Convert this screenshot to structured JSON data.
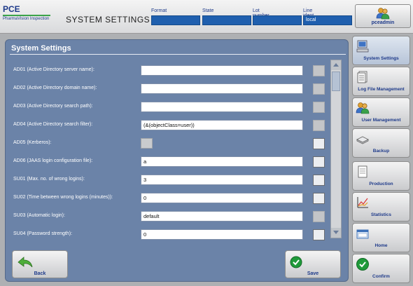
{
  "header": {
    "logo_title": "PCE",
    "logo_subtitle": "PharmaVision Inspection",
    "screen_title": "SYSTEM SETTINGS",
    "fields": [
      {
        "label": "Format",
        "value": ""
      },
      {
        "label": "State",
        "value": ""
      },
      {
        "label": "Lot number",
        "value": ""
      },
      {
        "label": "Line ident",
        "value": "local"
      }
    ],
    "user": "pceadmin"
  },
  "panel": {
    "title": "System Settings",
    "rows": [
      {
        "label": "AD01 (Active Directory server name):",
        "type": "text",
        "value": "",
        "box": "disabled"
      },
      {
        "label": "AD02 (Active Directory domain name):",
        "type": "text",
        "value": "",
        "box": "disabled"
      },
      {
        "label": "AD03 (Active Directory search path):",
        "type": "text",
        "value": "",
        "box": "disabled"
      },
      {
        "label": "AD04 (Active Directory search filter):",
        "type": "text",
        "value": "(&(objectClass=user))",
        "box": "disabled"
      },
      {
        "label": "AD05 (Kerberos):",
        "type": "check",
        "value": "",
        "box": "enabled"
      },
      {
        "label": "AD06 (JAAS login configuration file):",
        "type": "text",
        "value": "a",
        "box": "enabled"
      },
      {
        "label": "SU01 (Max. no. of wrong logins):",
        "type": "text",
        "value": "3",
        "box": "enabled"
      },
      {
        "label": "SU02 (Time between wrong logins (minutes)):",
        "type": "text",
        "value": "0",
        "box": "enabled"
      },
      {
        "label": "SU03 (Automatic login):",
        "type": "text",
        "value": "default",
        "box": "disabled"
      },
      {
        "label": "SU04 (Password strength):",
        "type": "text",
        "value": "0",
        "box": "enabled"
      }
    ],
    "back_label": "Back",
    "save_label": "Save"
  },
  "nav": [
    {
      "label": "System Settings",
      "icon": "computer-icon",
      "active": true
    },
    {
      "label": "Log File Management",
      "icon": "document-icon",
      "active": false
    },
    {
      "label": "User Management",
      "icon": "users-icon",
      "active": false
    },
    {
      "label": "Backup",
      "icon": "backup-icon",
      "active": false
    },
    {
      "label": "Production",
      "icon": "production-icon",
      "active": false
    },
    {
      "label": "Statistics",
      "icon": "chart-icon",
      "active": false
    },
    {
      "label": "Home",
      "icon": "home-icon",
      "active": false
    },
    {
      "label": "Confirm",
      "icon": "confirm-icon",
      "active": false
    }
  ],
  "colors": {
    "panel": "#6b83a8",
    "header_field": "#1f5fae",
    "label_blue": "#1e3a8a",
    "confirm_green": "#1f9a3a"
  }
}
